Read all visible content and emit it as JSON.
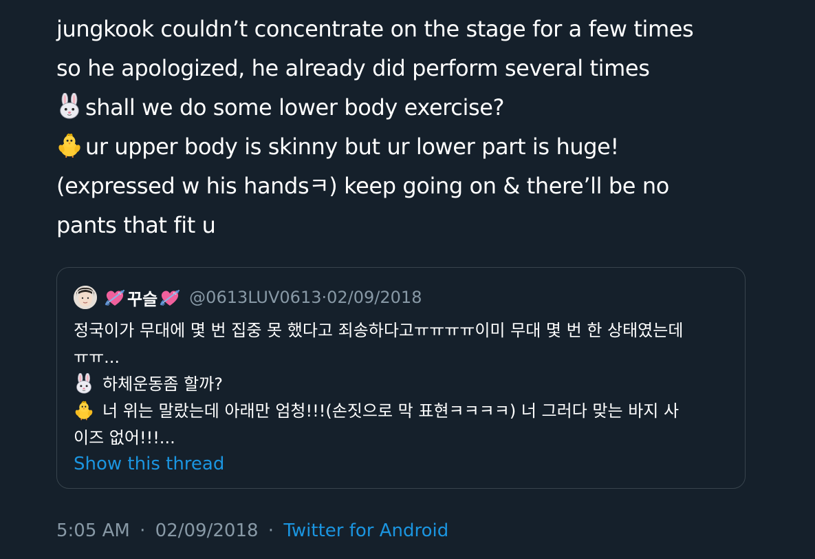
{
  "tweet": {
    "lines": [
      "jungkook couldn’t concentrate on the stage for a few times",
      "so he apologized, he already did perform several times",
      "shall we do some lower body exercise?",
      "ur upper body is skinny but ur lower part is huge!",
      "(expressed w his handsㅋ) keep going on & there’ll be no",
      "pants that fit u"
    ],
    "time": "5:05 AM",
    "date": "02/09/2018",
    "client": "Twitter for Android",
    "separator": "·"
  },
  "quote": {
    "display_name": "꾸슬",
    "handle": "@0613LUV0613",
    "separator": "·",
    "date": "02/09/2018",
    "lines": [
      "정국이가 무대에 몇 번 집중 못 했다고 죄송하다고ㅠㅠㅠㅠ이미 무대 몇 번 한 상태였는데",
      "ㅠㅠ...",
      "하체운동좀 할까?",
      "너 위는 말랐는데 아래만 엄청!!!(손짓으로 막 표현ㅋㅋㅋㅋ) 너 그러다 맞는 바지 사",
      "이즈 없어!!!..."
    ],
    "show_thread": "Show this thread"
  },
  "icons": {
    "rabbit": "rabbit-face-emoji",
    "chick": "baby-chick-emoji",
    "heart": "heart-with-arrow-emoji"
  },
  "colors": {
    "background": "#15202b",
    "text": "#ffffff",
    "secondary": "#8899a6",
    "link": "#1b95e0",
    "border": "#38444d"
  }
}
